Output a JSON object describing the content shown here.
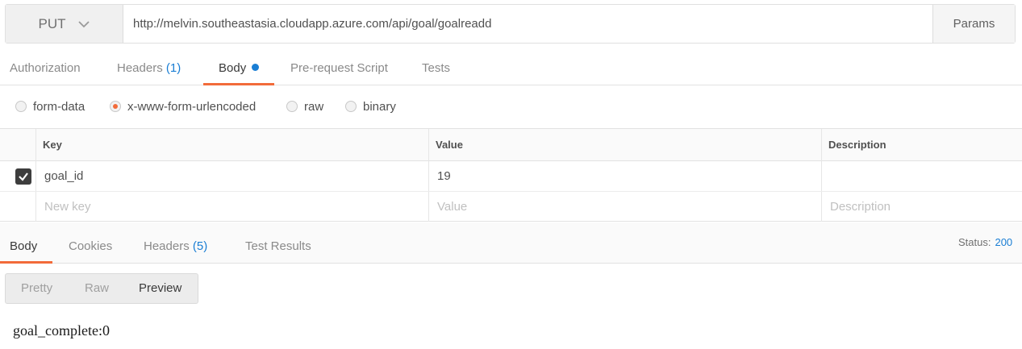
{
  "request": {
    "method": "PUT",
    "url": "http://melvin.southeastasia.cloudapp.azure.com/api/goal/goalreadd",
    "params_label": "Params"
  },
  "request_tabs": {
    "authorization": "Authorization",
    "headers": "Headers",
    "headers_count": "(1)",
    "body": "Body",
    "pre_request": "Pre-request Script",
    "tests": "Tests"
  },
  "body_types": {
    "form_data": "form-data",
    "urlencoded": "x-www-form-urlencoded",
    "raw": "raw",
    "binary": "binary",
    "selected": "x-www-form-urlencoded"
  },
  "table": {
    "columns": {
      "key": "Key",
      "value": "Value",
      "description": "Description"
    },
    "rows": [
      {
        "checked": true,
        "key": "goal_id",
        "value": "19",
        "description": ""
      }
    ],
    "placeholders": {
      "key": "New key",
      "value": "Value",
      "description": "Description"
    }
  },
  "response_tabs": {
    "body": "Body",
    "cookies": "Cookies",
    "headers": "Headers",
    "headers_count": "(5)",
    "test_results": "Test Results"
  },
  "status": {
    "label": "Status:",
    "code": "200"
  },
  "view_modes": {
    "pretty": "Pretty",
    "raw": "Raw",
    "preview": "Preview",
    "active": "Preview"
  },
  "response_output": "goal_complete:0",
  "colors": {
    "accent": "#f26b3a",
    "link": "#1a7ed4"
  }
}
